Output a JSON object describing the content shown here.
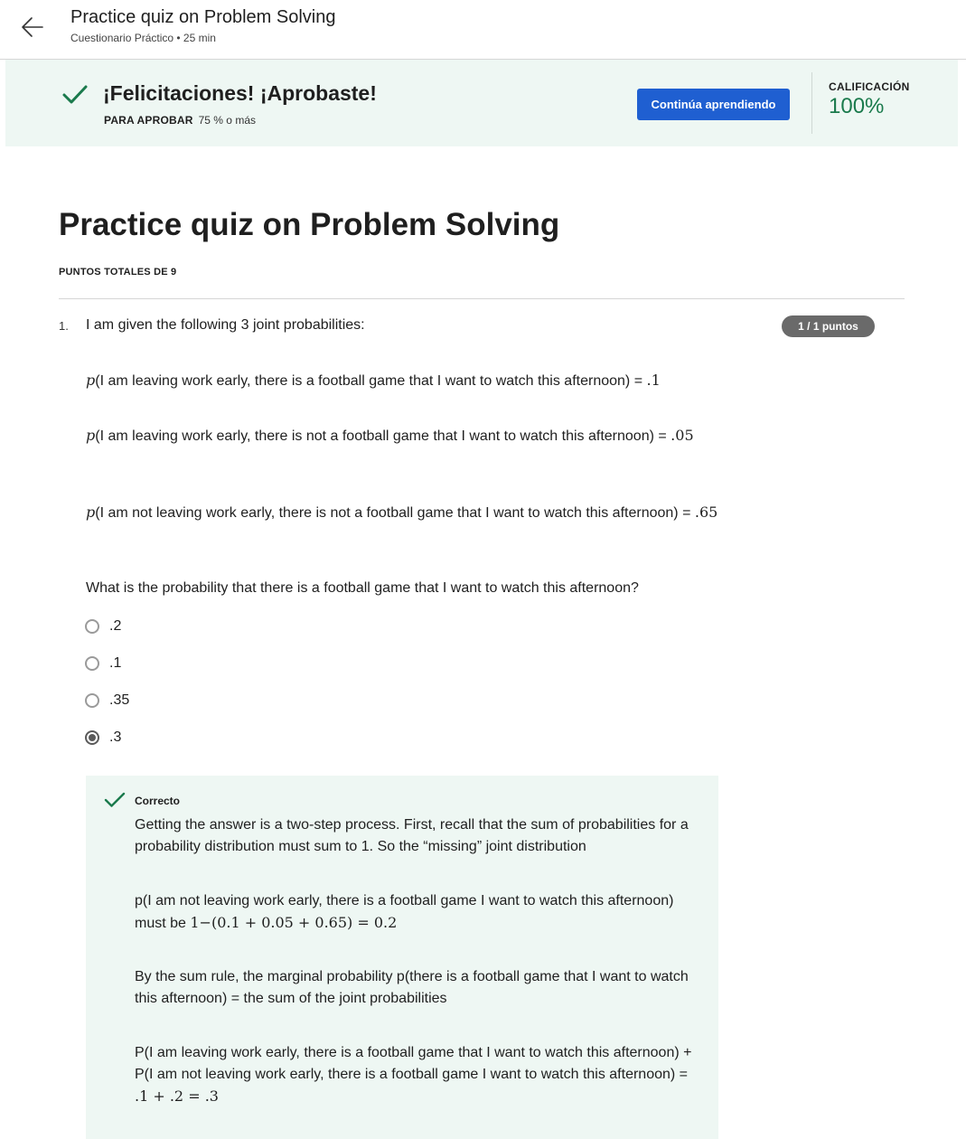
{
  "header": {
    "title": "Practice quiz on Problem Solving",
    "subtitle": "Cuestionario Práctico • 25 min"
  },
  "banner": {
    "message": "¡Felicitaciones! ¡Aprobaste!",
    "pass_label": "PARA APROBAR",
    "pass_value": "75 % o más",
    "continue_label": "Continúa aprendiendo",
    "grade_label": "CALIFICACIÓN",
    "grade_value": "100%",
    "accent_color": "#1a7a4c",
    "button_color": "#1f5fd1"
  },
  "quiz": {
    "title": "Practice quiz on Problem Solving",
    "total_points": "PUNTOS TOTALES DE 9"
  },
  "question1": {
    "number": "1.",
    "intro": "I am given the following 3 joint probabilities:",
    "points": "1 / 1 puntos",
    "probabilities": [
      {
        "p": "p",
        "text": "(I am leaving work early, there is a football game that I want to watch this afternoon) = ",
        "value": ".1"
      },
      {
        "p": "p",
        "text": "(I am leaving work early, there is not a football game that I want to watch this afternoon) = ",
        "value": ".05"
      },
      {
        "p": "p",
        "text": "(I am not leaving work early, there is not a football game that I want to watch this afternoon) = ",
        "value": ".65"
      }
    ],
    "question": "What is the probability that there is a football game that I want to watch this afternoon?",
    "options": [
      {
        "label": ".2",
        "selected": false
      },
      {
        "label": ".1",
        "selected": false
      },
      {
        "label": ".35",
        "selected": false
      },
      {
        "label": ".3",
        "selected": true
      }
    ],
    "feedback": {
      "status": "Correcto",
      "p1": "Getting the answer is a two-step process. First, recall that the sum of probabilities for a probability distribution must sum to 1. So the “missing” joint distribution",
      "p2_text": "p(I am not leaving work early, there is a football game I want to watch this afternoon) must be ",
      "p2_math": "1−(0.1 + 0.05 + 0.65) = 0.2",
      "p3": "By the sum rule, the marginal probability p(there is a football game that I want to watch this afternoon) = the sum of the joint probabilities",
      "p4_text": "P(I am leaving work early, there is a football game that I want to watch this afternoon) + P(I am not leaving work early, there is a football game I want to watch this afternoon) = ",
      "p4_math": ".1 + .2 = .3"
    }
  }
}
